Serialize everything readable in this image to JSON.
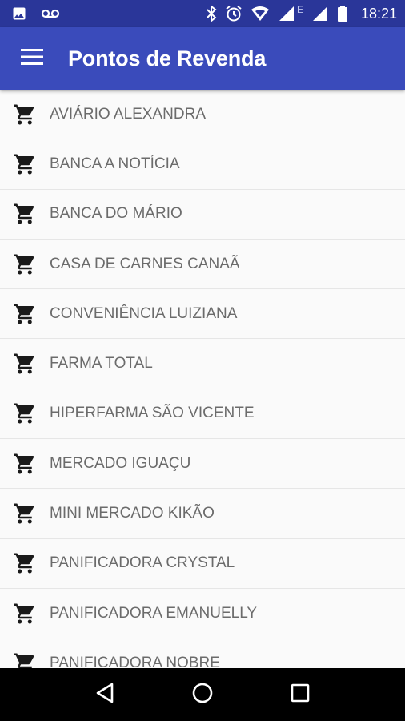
{
  "status_bar": {
    "time": "18:21",
    "network_label": "E",
    "icons": [
      "image-icon",
      "voicemail-icon",
      "bluetooth-icon",
      "alarm-icon",
      "wifi-icon",
      "signal-icon",
      "battery-icon"
    ]
  },
  "app_bar": {
    "title": "Pontos de Revenda",
    "background": "#3a4bbb",
    "status_background": "#2a3699"
  },
  "list": {
    "item_icon": "shopping-cart-icon",
    "items": [
      {
        "label": "AVIÁRIO ALEXANDRA"
      },
      {
        "label": "BANCA A NOTÍCIA"
      },
      {
        "label": "BANCA DO MÁRIO"
      },
      {
        "label": "CASA DE CARNES CANAÃ"
      },
      {
        "label": "CONVENIÊNCIA LUIZIANA"
      },
      {
        "label": "FARMA TOTAL"
      },
      {
        "label": "HIPERFARMA SÃO VICENTE"
      },
      {
        "label": "MERCADO IGUAÇU"
      },
      {
        "label": "MINI MERCADO KIKÃO"
      },
      {
        "label": "PANIFICADORA CRYSTAL"
      },
      {
        "label": "PANIFICADORA EMANUELLY"
      },
      {
        "label": "PANIFICADORA NOBRE"
      }
    ]
  },
  "nav_bar": {
    "buttons": [
      "back-icon",
      "home-icon",
      "recents-icon"
    ]
  }
}
